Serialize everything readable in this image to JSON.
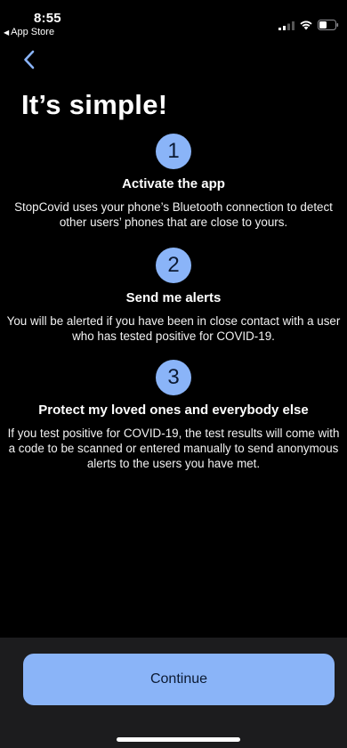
{
  "status_bar": {
    "time": "8:55",
    "back_app": "App Store"
  },
  "page": {
    "title": "It’s simple!"
  },
  "steps": [
    {
      "number": "1",
      "title": "Activate the app",
      "body": "StopCovid uses your phone’s Bluetooth connection to detect other users’ phones that are close to yours."
    },
    {
      "number": "2",
      "title": "Send me alerts",
      "body": "You will be alerted if you have been in close contact with a user who has tested positive for COVID-19."
    },
    {
      "number": "3",
      "title": "Protect my loved ones and everybody else",
      "body": "If you test positive for COVID-19, the test results will come with a code to be scanned or entered manually to send anonymous alerts to the users you have met."
    }
  ],
  "footer": {
    "continue_label": "Continue"
  },
  "colors": {
    "accent": "#8ab4f8",
    "background": "#000000",
    "footer_background": "#1c1c1e"
  }
}
